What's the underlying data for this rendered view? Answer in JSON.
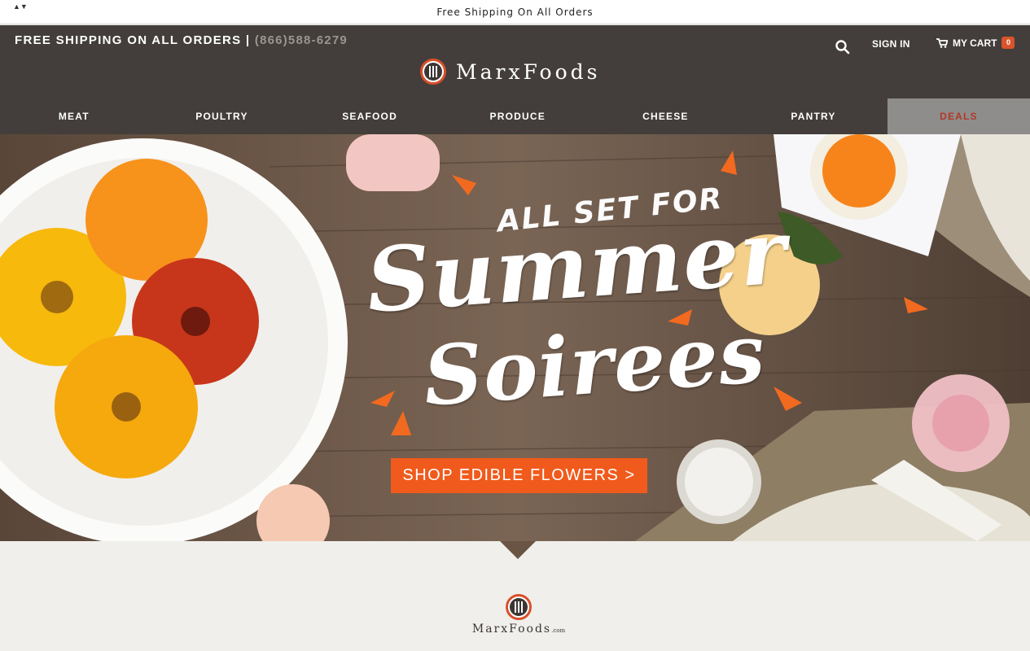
{
  "topbar": {
    "message": "Free Shipping On All Orders",
    "sort_arrows": "▲▼"
  },
  "header": {
    "shipping": "FREE SHIPPING ON ALL ORDERS |",
    "phone": "(866)588-6279",
    "brand": "MarxFoods",
    "search_icon": "search-icon",
    "signin": "SIGN IN",
    "cart_label": "MY CART",
    "cart_count": "0"
  },
  "nav": {
    "items": [
      {
        "label": "MEAT"
      },
      {
        "label": "POULTRY"
      },
      {
        "label": "SEAFOOD"
      },
      {
        "label": "PRODUCE"
      },
      {
        "label": "CHEESE"
      },
      {
        "label": "PANTRY"
      },
      {
        "label": "DEALS"
      }
    ]
  },
  "hero": {
    "headline_small": "ALL SET FOR",
    "headline_line1": "Summer",
    "headline_line2": "Soirees",
    "cta": "SHOP EDIBLE FLOWERS >"
  },
  "footer": {
    "brand": "MarxFoods",
    "suffix": ".com"
  },
  "colors": {
    "header_bg": "#433e3b",
    "accent": "#f05a1c",
    "deals_bg": "#8f8d8b",
    "deals_text": "#b0392a",
    "page_bg": "#f0efeb"
  }
}
